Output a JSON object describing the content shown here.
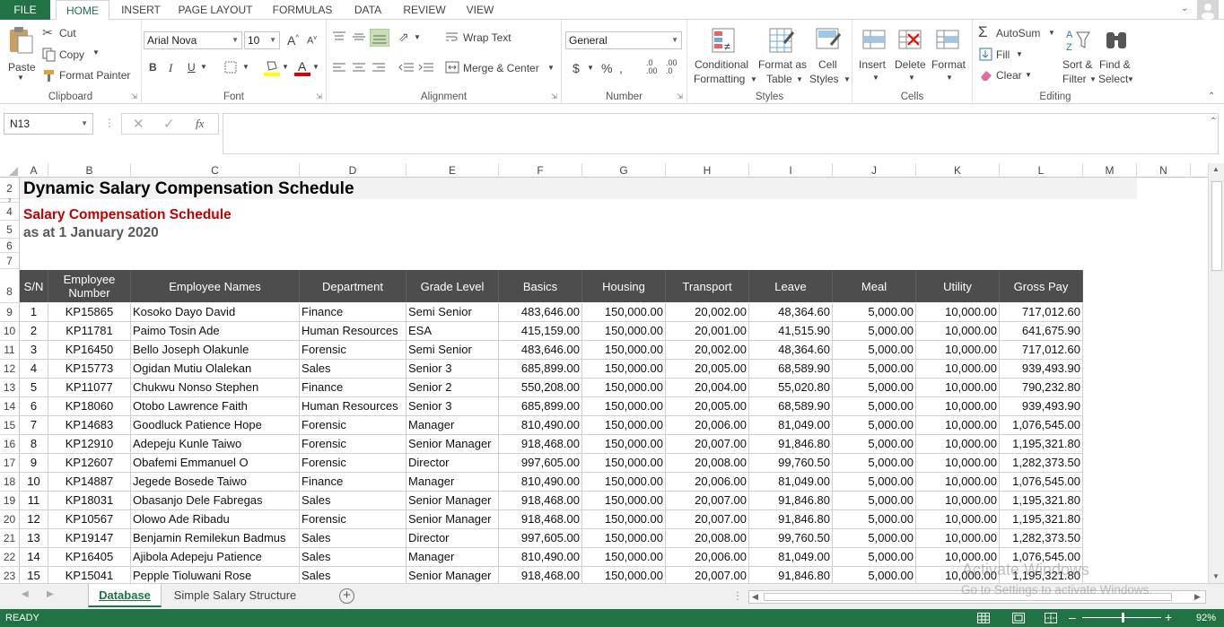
{
  "tabs": {
    "file": "FILE",
    "items": [
      "HOME",
      "INSERT",
      "PAGE LAYOUT",
      "FORMULAS",
      "DATA",
      "REVIEW",
      "VIEW"
    ]
  },
  "clipboard": {
    "paste": "Paste",
    "cut": "Cut",
    "copy": "Copy",
    "format_painter": "Format Painter",
    "label": "Clipboard"
  },
  "font": {
    "name": "Arial Nova",
    "size": "10",
    "label": "Font"
  },
  "alignment": {
    "wrap": "Wrap Text",
    "merge": "Merge & Center",
    "label": "Alignment"
  },
  "number": {
    "format": "General",
    "label": "Number"
  },
  "styles": {
    "cond1": "Conditional",
    "cond2": "Formatting",
    "fat1": "Format as",
    "fat2": "Table",
    "cs1": "Cell",
    "cs2": "Styles",
    "label": "Styles"
  },
  "cells": {
    "insert": "Insert",
    "delete": "Delete",
    "format": "Format",
    "label": "Cells"
  },
  "editing": {
    "autosum": "AutoSum",
    "fill": "Fill",
    "clear": "Clear",
    "sort1": "Sort &",
    "sort2": "Filter",
    "find1": "Find &",
    "find2": "Select",
    "label": "Editing"
  },
  "namebox": "N13",
  "columns": [
    "A",
    "B",
    "C",
    "D",
    "E",
    "F",
    "G",
    "H",
    "I",
    "J",
    "K",
    "L",
    "M",
    "N"
  ],
  "rows": [
    "2",
    "3",
    "4",
    "5",
    "6",
    "7",
    "8",
    "9",
    "10",
    "11",
    "12",
    "13",
    "14",
    "15",
    "16",
    "17",
    "18",
    "19",
    "20",
    "21",
    "22",
    "23"
  ],
  "title": "Dynamic Salary Compensation Schedule",
  "subtitle": "Salary Compensation Schedule",
  "asat": "as at 1 January 2020",
  "headers": [
    "S/N",
    "Employee Number",
    "Employee Names",
    "Department",
    "Grade Level",
    "Basics",
    "Housing",
    "Transport",
    "Leave",
    "Meal",
    "Utility",
    "Gross Pay"
  ],
  "data": [
    [
      "1",
      "KP15865",
      "Kosoko Dayo David",
      "Finance",
      "Semi Senior",
      "483,646.00",
      "150,000.00",
      "20,002.00",
      "48,364.60",
      "5,000.00",
      "10,000.00",
      "717,012.60"
    ],
    [
      "2",
      "KP11781",
      "Paimo Tosin Ade",
      "Human Resources",
      "ESA",
      "415,159.00",
      "150,000.00",
      "20,001.00",
      "41,515.90",
      "5,000.00",
      "10,000.00",
      "641,675.90"
    ],
    [
      "3",
      "KP16450",
      "Bello Joseph Olakunle",
      "Forensic",
      "Semi Senior",
      "483,646.00",
      "150,000.00",
      "20,002.00",
      "48,364.60",
      "5,000.00",
      "10,000.00",
      "717,012.60"
    ],
    [
      "4",
      "KP15773",
      "Ogidan Mutiu Olalekan",
      "Sales",
      "Senior 3",
      "685,899.00",
      "150,000.00",
      "20,005.00",
      "68,589.90",
      "5,000.00",
      "10,000.00",
      "939,493.90"
    ],
    [
      "5",
      "KP11077",
      "Chukwu Nonso Stephen",
      "Finance",
      "Senior 2",
      "550,208.00",
      "150,000.00",
      "20,004.00",
      "55,020.80",
      "5,000.00",
      "10,000.00",
      "790,232.80"
    ],
    [
      "6",
      "KP18060",
      "Otobo Lawrence Faith",
      "Human Resources",
      "Senior 3",
      "685,899.00",
      "150,000.00",
      "20,005.00",
      "68,589.90",
      "5,000.00",
      "10,000.00",
      "939,493.90"
    ],
    [
      "7",
      "KP14683",
      "Goodluck Patience Hope",
      "Forensic",
      "Manager",
      "810,490.00",
      "150,000.00",
      "20,006.00",
      "81,049.00",
      "5,000.00",
      "10,000.00",
      "1,076,545.00"
    ],
    [
      "8",
      "KP12910",
      "Adepeju Kunle Taiwo",
      "Forensic",
      "Senior Manager",
      "918,468.00",
      "150,000.00",
      "20,007.00",
      "91,846.80",
      "5,000.00",
      "10,000.00",
      "1,195,321.80"
    ],
    [
      "9",
      "KP12607",
      "Obafemi Emmanuel O",
      "Forensic",
      "Director",
      "997,605.00",
      "150,000.00",
      "20,008.00",
      "99,760.50",
      "5,000.00",
      "10,000.00",
      "1,282,373.50"
    ],
    [
      "10",
      "KP14887",
      "Jegede Bosede Taiwo",
      "Finance",
      "Manager",
      "810,490.00",
      "150,000.00",
      "20,006.00",
      "81,049.00",
      "5,000.00",
      "10,000.00",
      "1,076,545.00"
    ],
    [
      "11",
      "KP18031",
      "Obasanjo Dele Fabregas",
      "Sales",
      "Senior Manager",
      "918,468.00",
      "150,000.00",
      "20,007.00",
      "91,846.80",
      "5,000.00",
      "10,000.00",
      "1,195,321.80"
    ],
    [
      "12",
      "KP10567",
      "Olowo Ade Ribadu",
      "Forensic",
      "Senior Manager",
      "918,468.00",
      "150,000.00",
      "20,007.00",
      "91,846.80",
      "5,000.00",
      "10,000.00",
      "1,195,321.80"
    ],
    [
      "13",
      "KP19147",
      "Benjamin Remilekun Badmus",
      "Sales",
      "Director",
      "997,605.00",
      "150,000.00",
      "20,008.00",
      "99,760.50",
      "5,000.00",
      "10,000.00",
      "1,282,373.50"
    ],
    [
      "14",
      "KP16405",
      "Ajibola Adepeju Patience",
      "Sales",
      "Manager",
      "810,490.00",
      "150,000.00",
      "20,006.00",
      "81,049.00",
      "5,000.00",
      "10,000.00",
      "1,076,545.00"
    ],
    [
      "15",
      "KP15041",
      "Pepple Tioluwani Rose",
      "Sales",
      "Senior Manager",
      "918,468.00",
      "150,000.00",
      "20,007.00",
      "91,846.80",
      "5,000.00",
      "10,000.00",
      "1,195,321.80"
    ]
  ],
  "sheets": [
    "Database",
    "Simple Salary Structure"
  ],
  "status": {
    "ready": "READY",
    "zoom": "92%"
  },
  "watermark": {
    "line1": "Activate Windows",
    "line2": "Go to Settings to activate Windows."
  },
  "colors": {
    "excel_green": "#217346",
    "header_bg": "#4d4d4d",
    "subtitle_red": "#c00000"
  }
}
